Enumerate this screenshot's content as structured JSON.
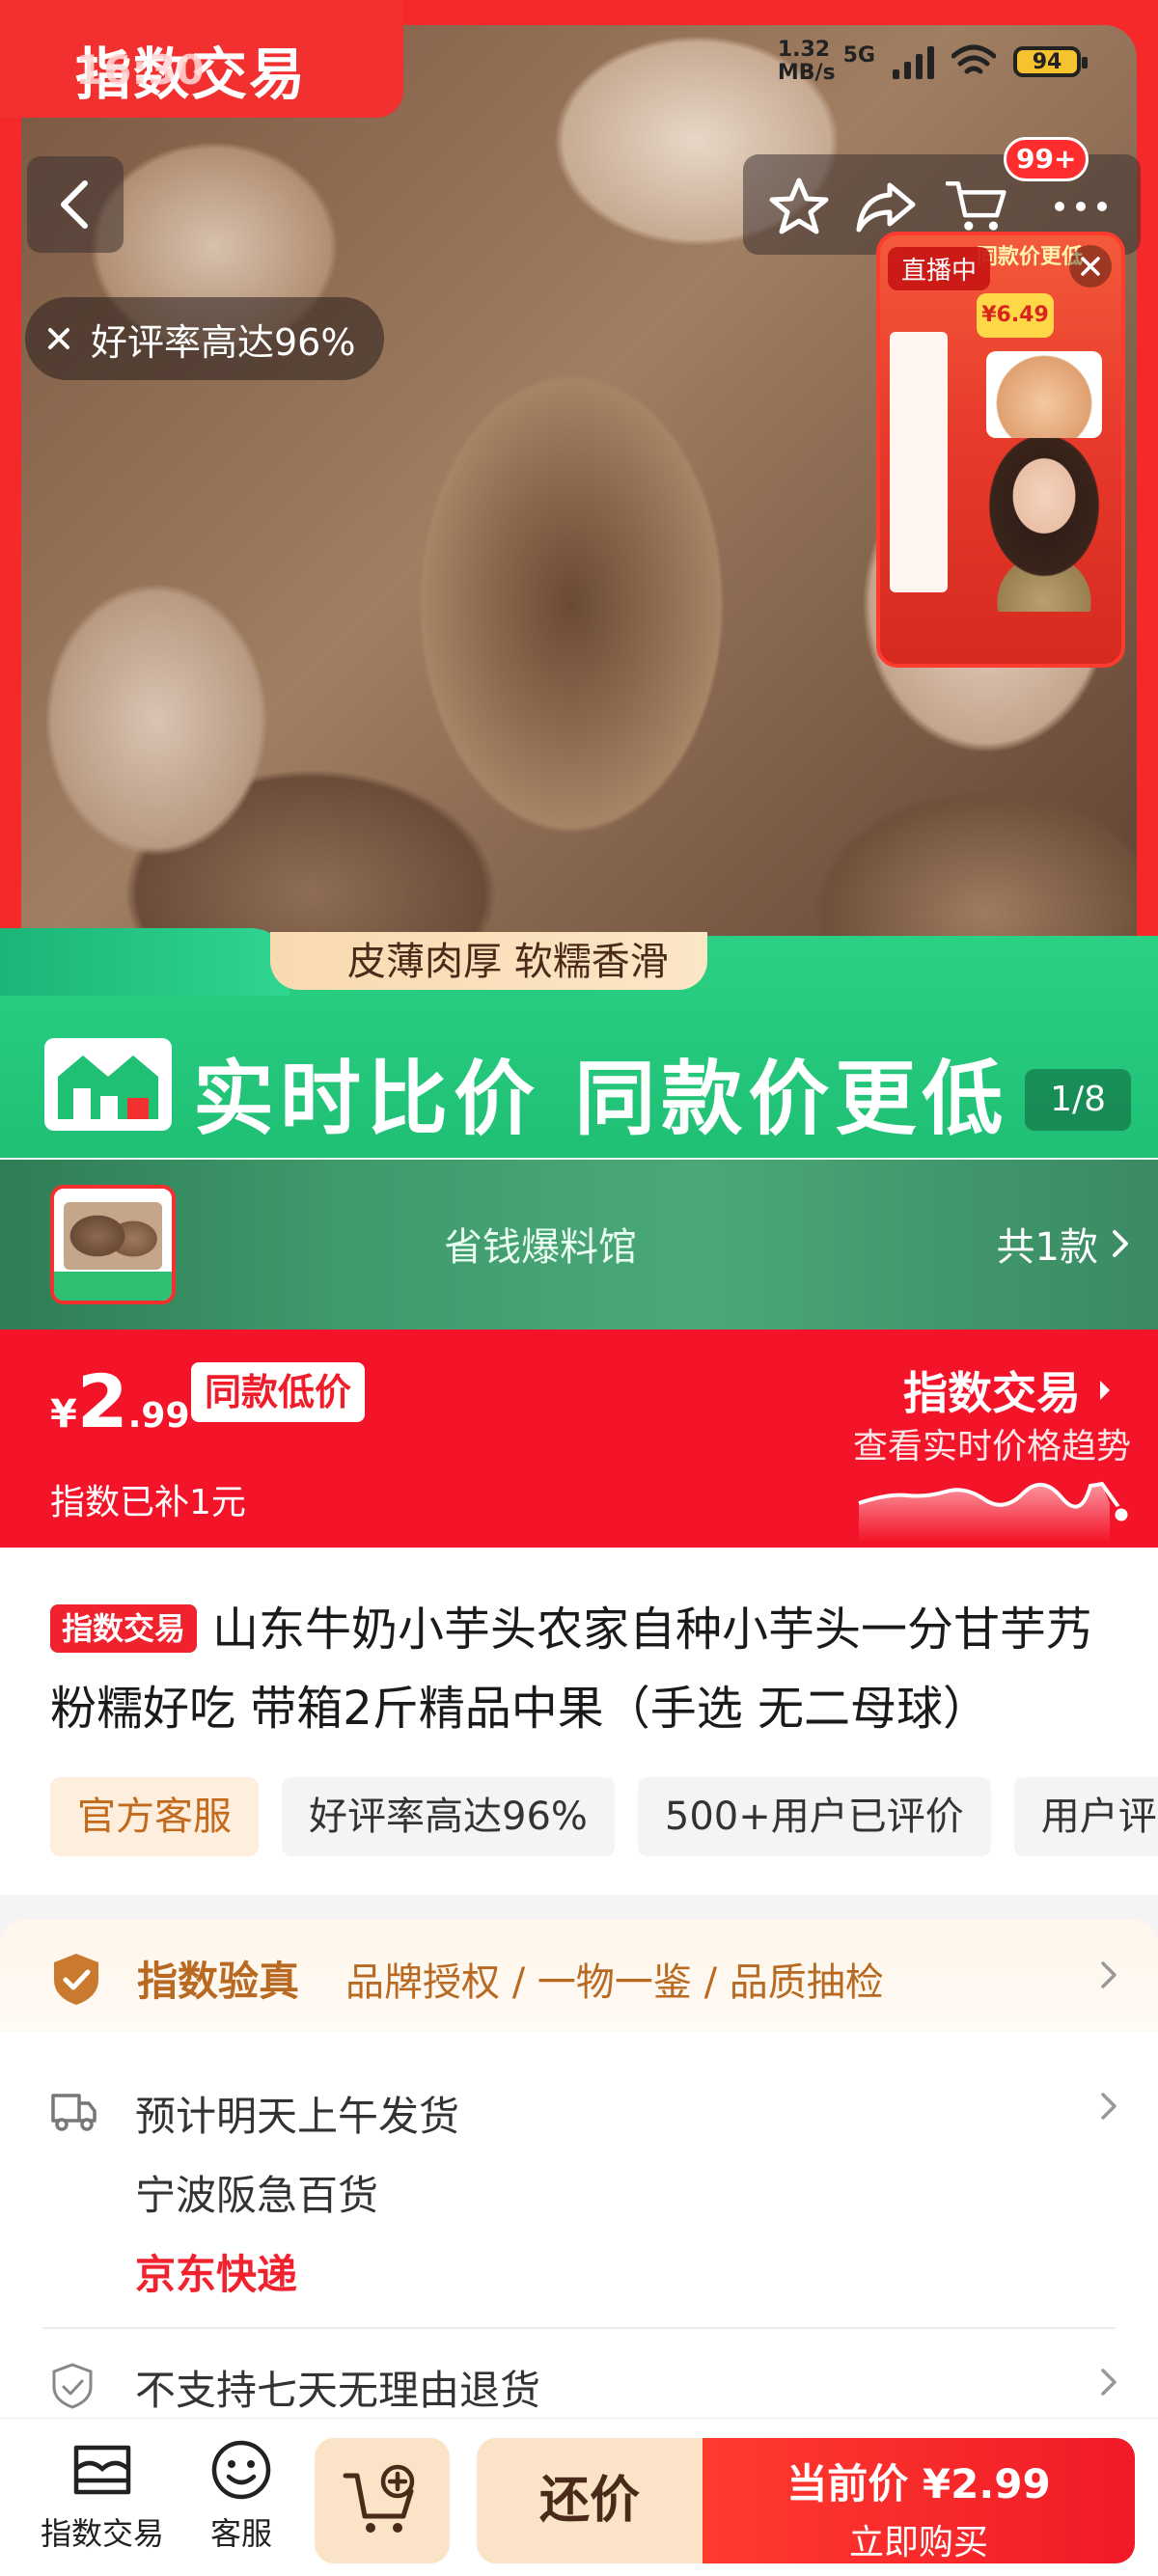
{
  "status_bar": {
    "time": "16:30",
    "net_speed_value": "1.32",
    "net_speed_unit": "MB/s",
    "network": "5G",
    "battery": "94"
  },
  "brand_tag": "指数交易",
  "header": {
    "cart_badge": "99+"
  },
  "rating_pill": {
    "text": "好评率高达96%"
  },
  "live": {
    "badge": "直播中",
    "headline": "同款价更低",
    "price": "¥6.49"
  },
  "promo": {
    "small_caption": "皮薄肉厚 软糯香滑",
    "banner_text": "实时比价 同款价更低"
  },
  "image_counter": "1/8",
  "shop": {
    "name": "省钱爆料馆",
    "count": "共1款"
  },
  "price": {
    "currency": "¥",
    "integer": "2",
    "decimal": ".99",
    "badge": "同款低价",
    "subsidy": "指数已补1元",
    "trend_title": "指数交易",
    "trend_subtitle": "查看实时价格趋势"
  },
  "product": {
    "tag": "指数交易",
    "title": "山东牛奶小芋头农家自种小芋头一分甘芋艿粉糯好吃 带箱2斤精品中果（手选 无二母球）",
    "chips": [
      "官方客服",
      "好评率高达96%",
      "500+用户已评价",
      "用户评"
    ]
  },
  "verify": {
    "title": "指数验真",
    "items": "品牌授权 / 一物一鉴 / 品质抽检"
  },
  "delivery": {
    "eta": "预计明天上午发货",
    "seller": "宁波阪急百货",
    "courier": "京东快递",
    "return_policy": "不支持七天无理由退货"
  },
  "bottom_bar": {
    "store_label": "指数交易",
    "service_label": "客服",
    "bargain_label": "还价",
    "buy_price_label": "当前价 ¥2.99",
    "buy_label": "立即购买"
  },
  "colors": {
    "brand_red": "#f4142a",
    "promo_green": "#1fbf74",
    "gold": "#b86a22"
  }
}
